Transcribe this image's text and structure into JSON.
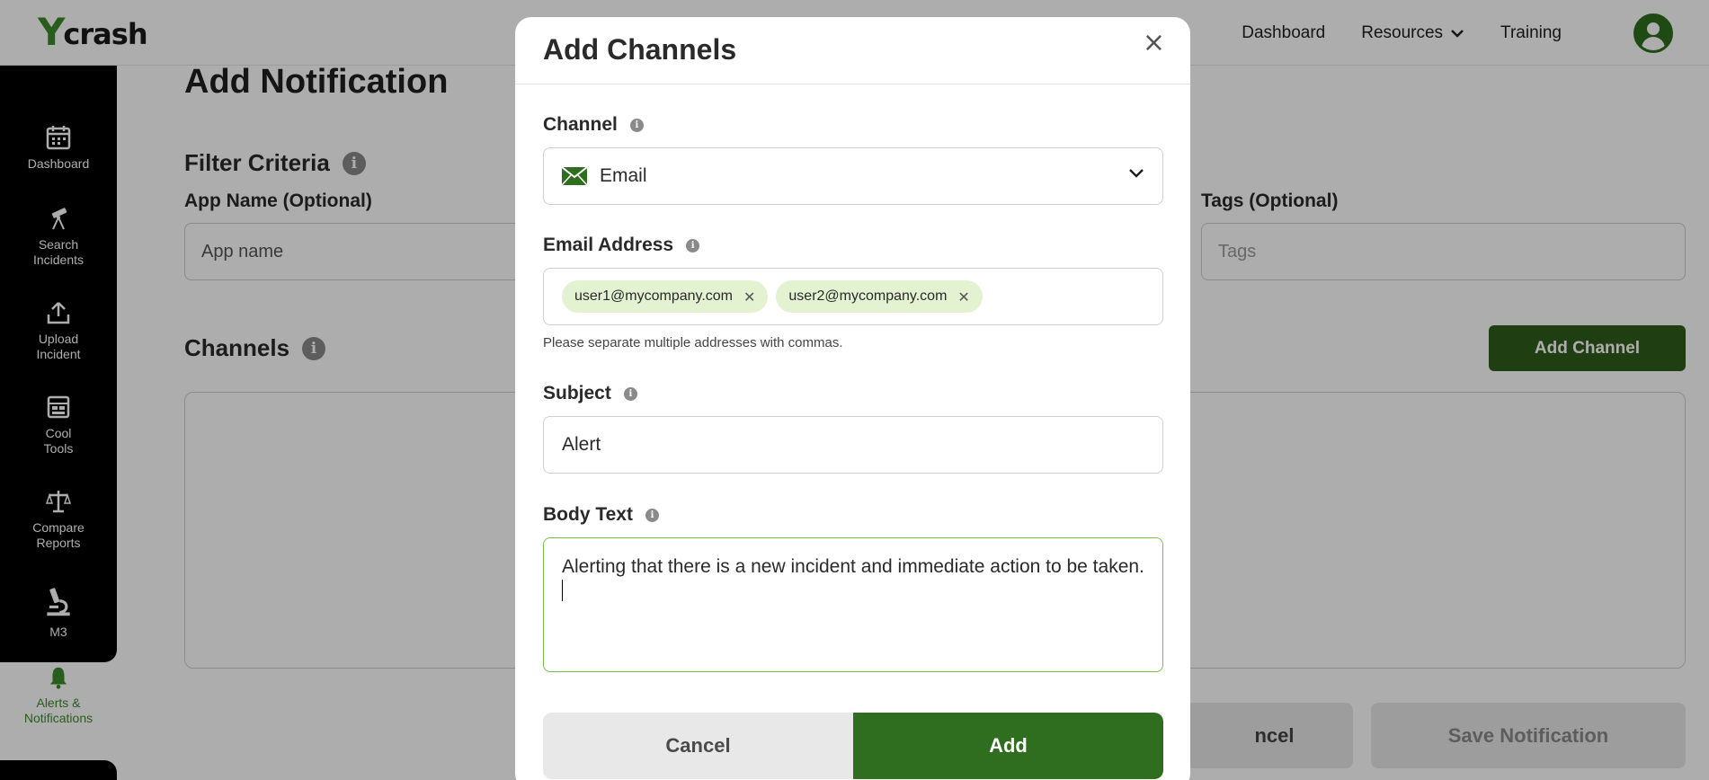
{
  "header": {
    "logo_mark": "Y",
    "logo_text": "crash",
    "nav": [
      {
        "label": "Dashboard"
      },
      {
        "label": "Resources"
      },
      {
        "label": "Training"
      }
    ]
  },
  "sidebar": {
    "items": [
      {
        "label": "Dashboard",
        "icon": "calendar-icon"
      },
      {
        "label": "Search Incidents",
        "icon": "telescope-icon"
      },
      {
        "label": "Upload Incident",
        "icon": "upload-icon"
      },
      {
        "label": "Cool Tools",
        "icon": "tools-grid-icon"
      },
      {
        "label": "Compare Reports",
        "icon": "balance-scale-icon"
      },
      {
        "label": "M3",
        "icon": "microscope-icon"
      }
    ],
    "active": {
      "label": "Alerts & Notifications",
      "icon": "bell-icon"
    }
  },
  "page": {
    "title": "Add Notification",
    "filter_title": "Filter Criteria",
    "app_name_label": "App Name (Optional)",
    "app_name_placeholder": "App name",
    "tags_label": "Tags (Optional)",
    "tags_placeholder": "Tags",
    "channels_title": "Channels",
    "add_channel_label": "Add Channel",
    "cancel_label": "Cancel",
    "cancel_visible": "ncel",
    "save_label": "Save Notification"
  },
  "modal": {
    "title": "Add Channels",
    "close_glyph": "×",
    "channel_label": "Channel",
    "channel_value": "Email",
    "email_label": "Email Address",
    "emails": [
      "user1@mycompany.com",
      "user2@mycompany.com"
    ],
    "email_hint": "Please separate multiple addresses with commas.",
    "subject_label": "Subject",
    "subject_value": "Alert",
    "body_label": "Body Text",
    "body_value": "Alerting that there is a new incident and immediate action to be taken.",
    "cancel_label": "Cancel",
    "add_label": "Add"
  },
  "colors": {
    "brand_green": "#2f6e1e",
    "chip_bg": "#e3f2d1",
    "focus_border": "#7cc24a",
    "sidebar_bg": "#000000"
  }
}
